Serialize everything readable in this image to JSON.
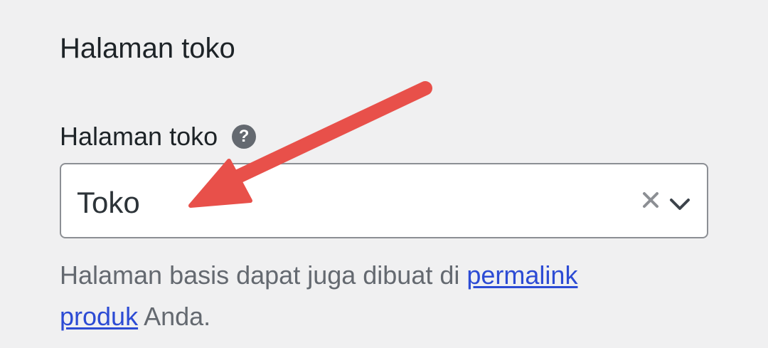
{
  "section": {
    "title": "Halaman toko"
  },
  "field": {
    "label": "Halaman toko",
    "help_icon": "question-circle-icon",
    "selected_value": "Toko",
    "clear_icon": "close-icon",
    "dropdown_icon": "chevron-down-icon"
  },
  "description": {
    "text_before": "Halaman basis dapat juga dibuat di ",
    "link_text": "permalink produk",
    "text_after": " Anda."
  },
  "annotation": {
    "type": "arrow",
    "color": "#e8504a"
  },
  "colors": {
    "background": "#f0f0f1",
    "text": "#1d2327",
    "muted_text": "#646970",
    "link": "#2c4bd4",
    "border": "#8c8f94"
  }
}
